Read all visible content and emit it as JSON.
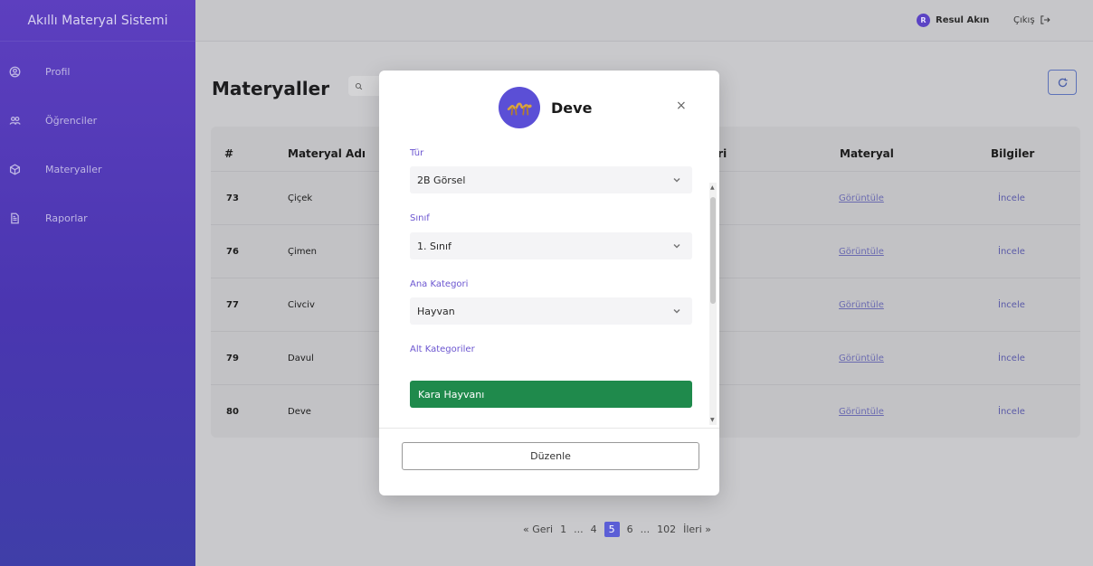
{
  "app": {
    "title": "Akıllı Materyal Sistemi"
  },
  "sidebar": {
    "items": [
      {
        "label": "Profil",
        "icon": "user-circle-icon"
      },
      {
        "label": "Öğrenciler",
        "icon": "users-icon"
      },
      {
        "label": "Materyaller",
        "icon": "cube-icon"
      },
      {
        "label": "Raporlar",
        "icon": "document-icon"
      }
    ]
  },
  "topbar": {
    "user_initial": "R",
    "user_name": "Resul Akın",
    "logout_label": "Çıkış"
  },
  "main": {
    "title": "Materyaller",
    "table": {
      "headers": [
        "#",
        "Materyal Adı",
        "ori",
        "Materyal",
        "Bilgiler"
      ],
      "rows": [
        {
          "id": "73",
          "name": "Çiçek",
          "view": "Görüntüle",
          "details": "İncele"
        },
        {
          "id": "76",
          "name": "Çimen",
          "view": "Görüntüle",
          "details": "İncele"
        },
        {
          "id": "77",
          "name": "Civciv",
          "view": "Görüntüle",
          "details": "İncele"
        },
        {
          "id": "79",
          "name": "Davul",
          "view": "Görüntüle",
          "details": "İncele"
        },
        {
          "id": "80",
          "name": "Deve",
          "view": "Görüntüle",
          "details": "İncele"
        }
      ]
    },
    "pagination": [
      "« Geri",
      "1",
      "...",
      "4",
      "5",
      "6",
      "...",
      "102",
      "İleri »"
    ],
    "pagination_active": "5"
  },
  "modal": {
    "title": "Deve",
    "close": "×",
    "fields": [
      {
        "label": "Tür",
        "value": "2B Görsel"
      },
      {
        "label": "Sınıf",
        "value": "1. Sınıf"
      },
      {
        "label": "Ana Kategori",
        "value": "Hayvan"
      }
    ],
    "subcategories_label": "Alt Kategoriler",
    "subcategory_tag": "Kara Hayvanı",
    "edit_button": "Düzenle"
  },
  "colors": {
    "accent": "#5b43c4",
    "tag_green": "#1f8a4c",
    "label_purple": "#6b55d0"
  }
}
